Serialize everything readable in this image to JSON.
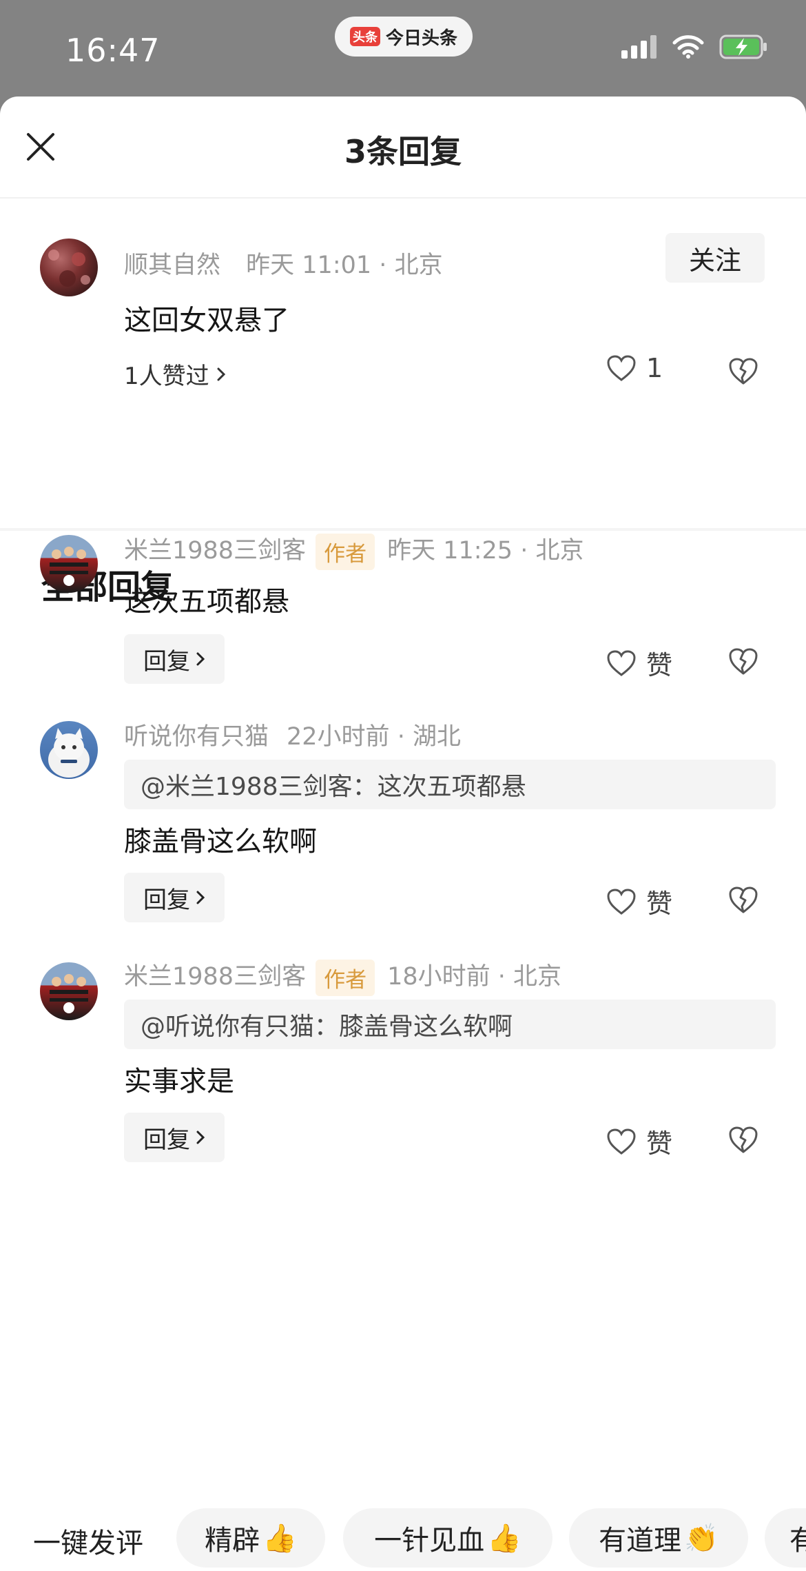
{
  "status_bar": {
    "time": "16:47",
    "app_logo_text": "头条",
    "app_name": "今日头条"
  },
  "header": {
    "title": "3条回复",
    "close_icon": "close-icon"
  },
  "main_comment": {
    "username": "顺其自然",
    "time": "昨天 11:01",
    "location": "北京",
    "follow_label": "关注",
    "text": "这回女双悬了",
    "liked_by": "1人赞过",
    "like_count": "1"
  },
  "replies_section": {
    "title": "全部回复"
  },
  "replies": [
    {
      "username": "米兰1988三剑客",
      "author_tag": "作者",
      "time": "昨天 11:25",
      "location": "北京",
      "quote": "",
      "text": "这次五项都悬",
      "reply_label": "回复",
      "like_label": "赞"
    },
    {
      "username": "听说你有只猫",
      "author_tag": "",
      "time": "22小时前",
      "location": "湖北",
      "quote": "@米兰1988三剑客：这次五项都悬",
      "text": "膝盖骨这么软啊",
      "reply_label": "回复",
      "like_label": "赞"
    },
    {
      "username": "米兰1988三剑客",
      "author_tag": "作者",
      "time": "18小时前",
      "location": "北京",
      "quote": "@听说你有只猫：膝盖骨这么软啊",
      "text": "实事求是",
      "reply_label": "回复",
      "like_label": "赞"
    }
  ],
  "quick_reply": {
    "label": "一键发评",
    "chips": [
      {
        "text": "精辟",
        "emoji": "👍"
      },
      {
        "text": "一针见血",
        "emoji": "👍"
      },
      {
        "text": "有道理",
        "emoji": "👏"
      },
      {
        "text": "有"
      }
    ]
  },
  "colors": {
    "author_tag_bg": "#fdf3e4",
    "author_tag_text": "#d89a3c",
    "status_bg": "#838383",
    "battery_green": "#5ac05a"
  }
}
